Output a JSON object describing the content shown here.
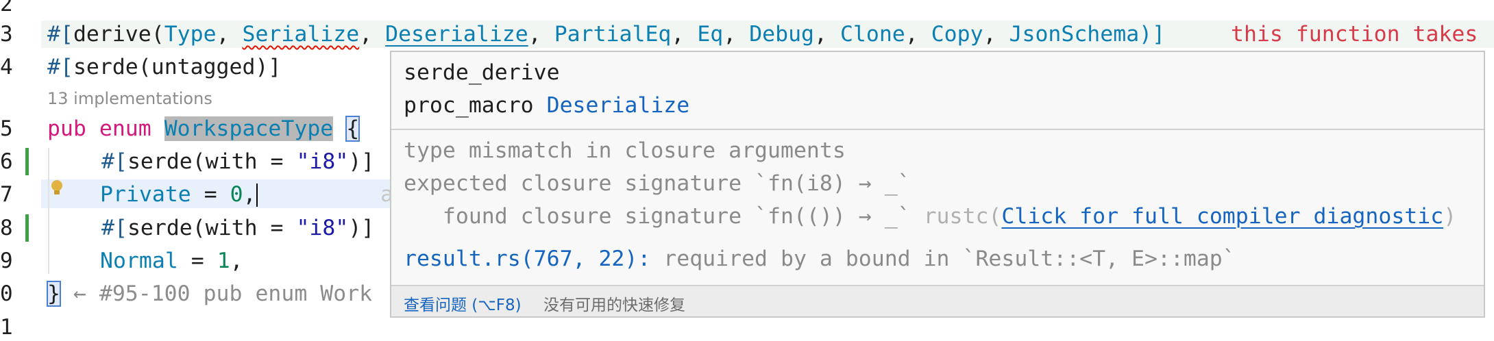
{
  "colors": {
    "keyword": "#d4197c",
    "type": "#0b7fb2",
    "string": "#1a1aa6",
    "error": "#d73a49",
    "link": "#1565c0",
    "modified_bar": "#3fa04a"
  },
  "gutter": {
    "line_numbers": [
      "2",
      "3",
      "4",
      "5",
      "6",
      "7",
      "8",
      "9",
      "0",
      "1"
    ]
  },
  "code": {
    "line3": {
      "hash": "#[",
      "derive": "derive",
      "open": "(",
      "t1": "Type",
      "c1": ", ",
      "t2": "Serialize",
      "c2": ", ",
      "t3": "Deserialize",
      "c3": ", ",
      "t4": "PartialEq",
      "c4": ", ",
      "t5": "Eq",
      "c5": ", ",
      "t6": "Debug",
      "c6": ", ",
      "t7": "Clone",
      "c7": ", ",
      "t8": "Copy",
      "c8": ", ",
      "t9": "JsonSchema",
      "close": ")]"
    },
    "inline_error": "this function takes",
    "line4": {
      "hash": "#[",
      "serde": "serde",
      "args": "(untagged)]"
    },
    "codelens": "13 implementations",
    "line5": {
      "kw1": "pub",
      "kw2": "enum",
      "name": "WorkspaceType",
      "brace": "{"
    },
    "line6": {
      "hash": "#[",
      "serde": "serde",
      "open": "(with = ",
      "str": "\"i8\"",
      "close": ")]"
    },
    "line7": {
      "variant": "Private",
      "eq": " = ",
      "num": "0",
      "comma": ",",
      "ghost": "a"
    },
    "line8": {
      "hash": "#[",
      "serde": "serde",
      "open": "(with = ",
      "str": "\"i8\"",
      "close": ")]"
    },
    "line9": {
      "variant": "Normal",
      "eq": " = ",
      "num": "1",
      "comma": ","
    },
    "line10": {
      "brace": "}",
      "hint": " ← #95-100 pub enum Work"
    }
  },
  "hover": {
    "crate": "serde_derive",
    "kind": "proc_macro",
    "symbol": "Deserialize",
    "diag1": "type mismatch in closure arguments",
    "diag2": "expected closure signature `fn(i8) → _`",
    "diag3_a": "   found closure signature `fn(()) → _` ",
    "diag3_rustc": "rustc(",
    "diag3_link": "Click for full compiler diagnostic",
    "diag3_close": ")",
    "note_link": "result.rs(767, 22):",
    "note_text": " required by a bound in `Result::<T, E>::map`",
    "footer_view": "查看问题 (⌥F8)",
    "footer_nofix": "没有可用的快速修复"
  }
}
